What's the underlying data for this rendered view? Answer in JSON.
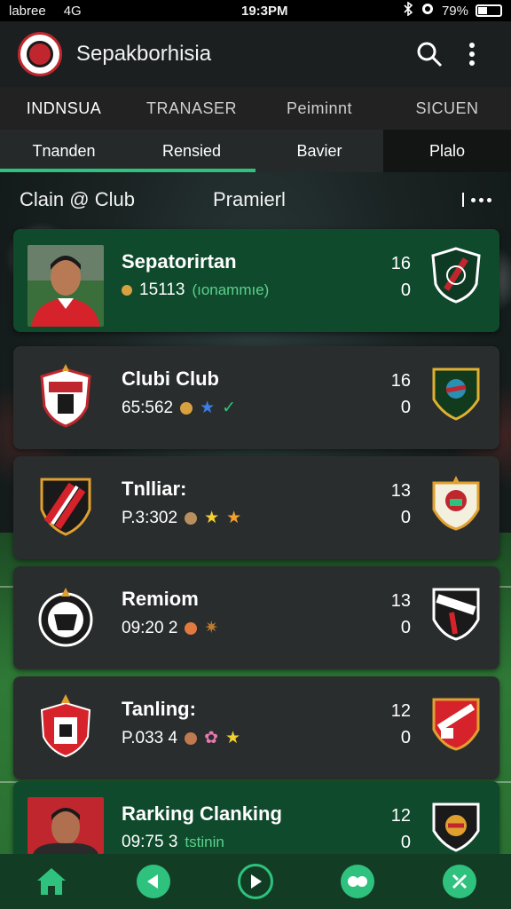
{
  "status_bar": {
    "carrier": "labree",
    "network": "4G",
    "time": "19:3PM",
    "battery": "79%"
  },
  "app_bar": {
    "title": "Sepakborhisia"
  },
  "tabs_top": [
    "INDNSUA",
    "TRANASER",
    "Peiminnt",
    "SICUEN"
  ],
  "tabs_sub": [
    "Tnanden",
    "Rensied",
    "Bavier",
    "Plalo"
  ],
  "filter": {
    "left": "Clain @ Club",
    "mid": "Pramierl"
  },
  "list": [
    {
      "name": "Sepatorirtan",
      "meta": "15113",
      "extra": "(ıonammıe)",
      "top": "16",
      "bottom": "0",
      "featured": true
    },
    {
      "name": "Clubi Club",
      "meta": "65:562",
      "top": "16",
      "bottom": "0"
    },
    {
      "name": "Tnlliar:",
      "meta": "P.3:302",
      "top": "13",
      "bottom": "0"
    },
    {
      "name": "Remiom",
      "meta": "09:20 2",
      "top": "13",
      "bottom": "0"
    },
    {
      "name": "Tanling:",
      "meta": "P.033 4",
      "top": "12",
      "bottom": "0"
    },
    {
      "name": "Rarking Clanking",
      "meta": "09:75 3",
      "extra": "tstinin",
      "top": "12",
      "bottom": "0"
    }
  ],
  "colors": {
    "accent": "#2ec27e",
    "featured_bg": "#0f4a2c",
    "card_bg": "#2a2d2d",
    "nav_bg": "#123d24"
  }
}
